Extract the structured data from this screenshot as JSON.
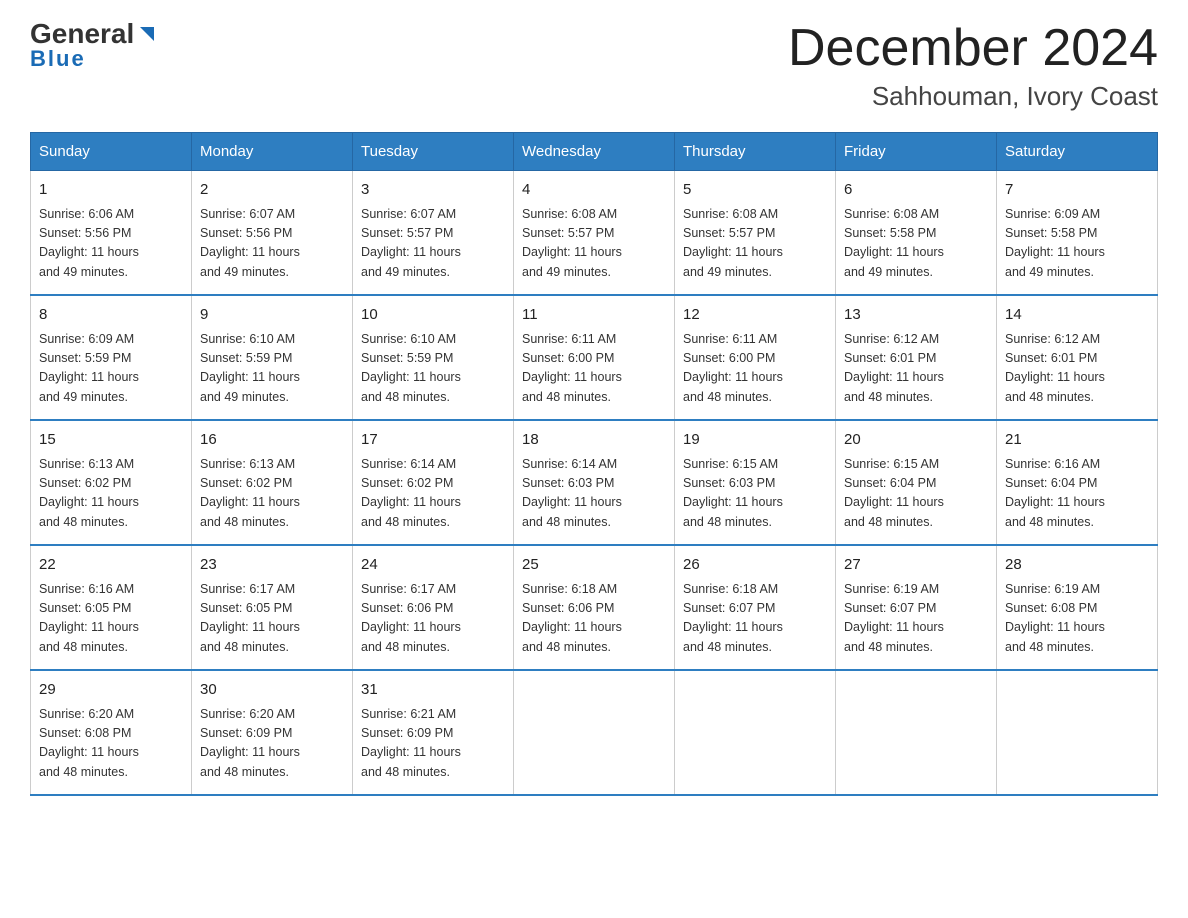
{
  "logo": {
    "general": "General",
    "blue": "Blue"
  },
  "header": {
    "month_year": "December 2024",
    "location": "Sahhouman, Ivory Coast"
  },
  "days_of_week": [
    "Sunday",
    "Monday",
    "Tuesday",
    "Wednesday",
    "Thursday",
    "Friday",
    "Saturday"
  ],
  "weeks": [
    [
      {
        "day": "1",
        "sunrise": "6:06 AM",
        "sunset": "5:56 PM",
        "daylight": "11 hours and 49 minutes."
      },
      {
        "day": "2",
        "sunrise": "6:07 AM",
        "sunset": "5:56 PM",
        "daylight": "11 hours and 49 minutes."
      },
      {
        "day": "3",
        "sunrise": "6:07 AM",
        "sunset": "5:57 PM",
        "daylight": "11 hours and 49 minutes."
      },
      {
        "day": "4",
        "sunrise": "6:08 AM",
        "sunset": "5:57 PM",
        "daylight": "11 hours and 49 minutes."
      },
      {
        "day": "5",
        "sunrise": "6:08 AM",
        "sunset": "5:57 PM",
        "daylight": "11 hours and 49 minutes."
      },
      {
        "day": "6",
        "sunrise": "6:08 AM",
        "sunset": "5:58 PM",
        "daylight": "11 hours and 49 minutes."
      },
      {
        "day": "7",
        "sunrise": "6:09 AM",
        "sunset": "5:58 PM",
        "daylight": "11 hours and 49 minutes."
      }
    ],
    [
      {
        "day": "8",
        "sunrise": "6:09 AM",
        "sunset": "5:59 PM",
        "daylight": "11 hours and 49 minutes."
      },
      {
        "day": "9",
        "sunrise": "6:10 AM",
        "sunset": "5:59 PM",
        "daylight": "11 hours and 49 minutes."
      },
      {
        "day": "10",
        "sunrise": "6:10 AM",
        "sunset": "5:59 PM",
        "daylight": "11 hours and 48 minutes."
      },
      {
        "day": "11",
        "sunrise": "6:11 AM",
        "sunset": "6:00 PM",
        "daylight": "11 hours and 48 minutes."
      },
      {
        "day": "12",
        "sunrise": "6:11 AM",
        "sunset": "6:00 PM",
        "daylight": "11 hours and 48 minutes."
      },
      {
        "day": "13",
        "sunrise": "6:12 AM",
        "sunset": "6:01 PM",
        "daylight": "11 hours and 48 minutes."
      },
      {
        "day": "14",
        "sunrise": "6:12 AM",
        "sunset": "6:01 PM",
        "daylight": "11 hours and 48 minutes."
      }
    ],
    [
      {
        "day": "15",
        "sunrise": "6:13 AM",
        "sunset": "6:02 PM",
        "daylight": "11 hours and 48 minutes."
      },
      {
        "day": "16",
        "sunrise": "6:13 AM",
        "sunset": "6:02 PM",
        "daylight": "11 hours and 48 minutes."
      },
      {
        "day": "17",
        "sunrise": "6:14 AM",
        "sunset": "6:02 PM",
        "daylight": "11 hours and 48 minutes."
      },
      {
        "day": "18",
        "sunrise": "6:14 AM",
        "sunset": "6:03 PM",
        "daylight": "11 hours and 48 minutes."
      },
      {
        "day": "19",
        "sunrise": "6:15 AM",
        "sunset": "6:03 PM",
        "daylight": "11 hours and 48 minutes."
      },
      {
        "day": "20",
        "sunrise": "6:15 AM",
        "sunset": "6:04 PM",
        "daylight": "11 hours and 48 minutes."
      },
      {
        "day": "21",
        "sunrise": "6:16 AM",
        "sunset": "6:04 PM",
        "daylight": "11 hours and 48 minutes."
      }
    ],
    [
      {
        "day": "22",
        "sunrise": "6:16 AM",
        "sunset": "6:05 PM",
        "daylight": "11 hours and 48 minutes."
      },
      {
        "day": "23",
        "sunrise": "6:17 AM",
        "sunset": "6:05 PM",
        "daylight": "11 hours and 48 minutes."
      },
      {
        "day": "24",
        "sunrise": "6:17 AM",
        "sunset": "6:06 PM",
        "daylight": "11 hours and 48 minutes."
      },
      {
        "day": "25",
        "sunrise": "6:18 AM",
        "sunset": "6:06 PM",
        "daylight": "11 hours and 48 minutes."
      },
      {
        "day": "26",
        "sunrise": "6:18 AM",
        "sunset": "6:07 PM",
        "daylight": "11 hours and 48 minutes."
      },
      {
        "day": "27",
        "sunrise": "6:19 AM",
        "sunset": "6:07 PM",
        "daylight": "11 hours and 48 minutes."
      },
      {
        "day": "28",
        "sunrise": "6:19 AM",
        "sunset": "6:08 PM",
        "daylight": "11 hours and 48 minutes."
      }
    ],
    [
      {
        "day": "29",
        "sunrise": "6:20 AM",
        "sunset": "6:08 PM",
        "daylight": "11 hours and 48 minutes."
      },
      {
        "day": "30",
        "sunrise": "6:20 AM",
        "sunset": "6:09 PM",
        "daylight": "11 hours and 48 minutes."
      },
      {
        "day": "31",
        "sunrise": "6:21 AM",
        "sunset": "6:09 PM",
        "daylight": "11 hours and 48 minutes."
      },
      null,
      null,
      null,
      null
    ]
  ],
  "labels": {
    "sunrise": "Sunrise:",
    "sunset": "Sunset:",
    "daylight": "Daylight:"
  }
}
